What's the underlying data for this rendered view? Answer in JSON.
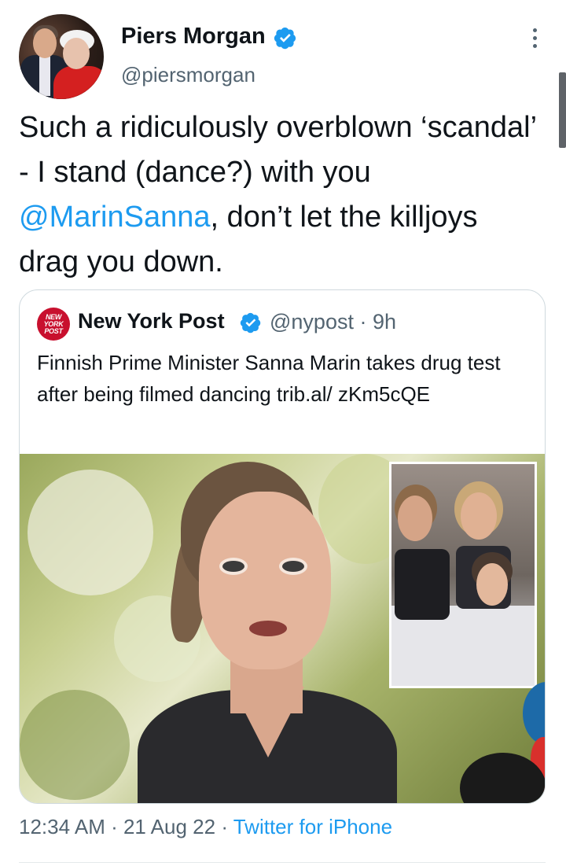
{
  "author": {
    "name": "Piers Morgan",
    "handle": "@piersmorgan",
    "verified": true,
    "avatar_icon": "profile-photo"
  },
  "tweet": {
    "text_before": "Such a ridiculously overblown ‘scandal’ - I stand (dance?) with you ",
    "mention": "@MarinSanna",
    "text_after": ", don’t let the killjoys drag you down."
  },
  "quoted_tweet": {
    "logo_text": "NEW YORK POST",
    "name": "New York Post",
    "verified": true,
    "handle_time": "@nypost · 9h",
    "text": "Finnish Prime Minister Sanna Marin takes drug test after being filmed dancing trib.al/ zKm5cQE",
    "media_icon": "news-photo"
  },
  "meta": {
    "time": "12:34 AM",
    "sep1": " · ",
    "date": "21 Aug 22",
    "sep2": " · ",
    "source": "Twitter for iPhone"
  },
  "colors": {
    "accent": "#1d9bf0",
    "secondary_text": "#536471",
    "border": "#cfd9de",
    "nypost_red": "#c8102e"
  }
}
